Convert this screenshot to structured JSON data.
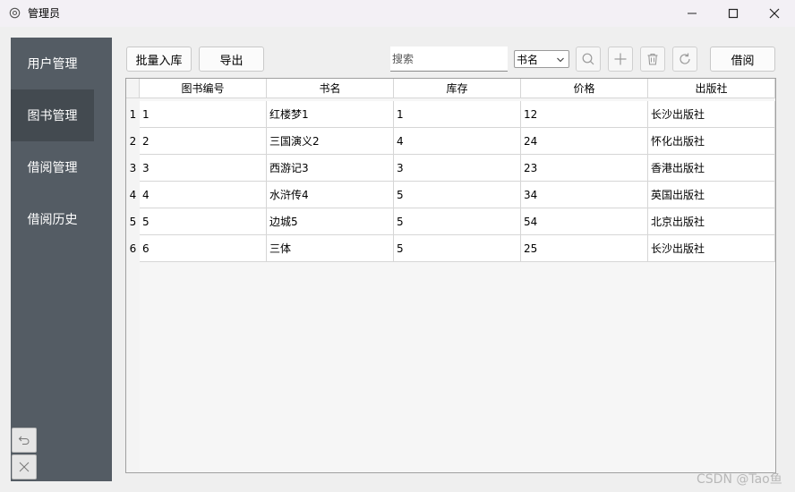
{
  "window": {
    "title": "管理员"
  },
  "sidebar": {
    "items": [
      {
        "label": "用户管理",
        "active": false
      },
      {
        "label": "图书管理",
        "active": true
      },
      {
        "label": "借阅管理",
        "active": false
      },
      {
        "label": "借阅历史",
        "active": false
      }
    ]
  },
  "toolbar": {
    "import_label": "批量入库",
    "export_label": "导出",
    "search_placeholder": "搜索",
    "search_field_selected": "书名",
    "borrow_label": "借阅"
  },
  "table": {
    "columns": [
      "图书编号",
      "书名",
      "库存",
      "价格",
      "出版社"
    ],
    "rows": [
      {
        "num": "1",
        "cells": [
          "1",
          "红楼梦1",
          "1",
          "12",
          "长沙出版社"
        ]
      },
      {
        "num": "2",
        "cells": [
          "2",
          "三国演义2",
          "4",
          "24",
          "怀化出版社"
        ]
      },
      {
        "num": "3",
        "cells": [
          "3",
          "西游记3",
          "3",
          "23",
          "香港出版社"
        ]
      },
      {
        "num": "4",
        "cells": [
          "4",
          "水浒传4",
          "5",
          "34",
          "英国出版社"
        ]
      },
      {
        "num": "5",
        "cells": [
          "5",
          "边城5",
          "5",
          "54",
          "北京出版社"
        ]
      },
      {
        "num": "6",
        "cells": [
          "6",
          "三体",
          "5",
          "25",
          "长沙出版社"
        ]
      }
    ]
  },
  "watermark": "CSDN @Tao鱼",
  "colors": {
    "sidebar_bg": "#545c64",
    "sidebar_active": "#434a50",
    "sidebar_text": "#ffffff"
  }
}
